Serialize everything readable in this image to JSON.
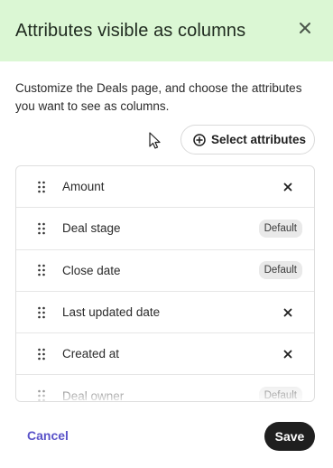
{
  "header": {
    "title": "Attributes visible as columns",
    "close_icon": "close-icon"
  },
  "description": "Customize the Deals page, and choose the attributes you want to see as columns.",
  "select_button": {
    "label": "Select attributes",
    "icon": "plus-circle-icon"
  },
  "attributes": [
    {
      "label": "Amount",
      "action": "remove"
    },
    {
      "label": "Deal stage",
      "badge": "Default"
    },
    {
      "label": "Close date",
      "badge": "Default"
    },
    {
      "label": "Last updated date",
      "action": "remove"
    },
    {
      "label": "Created at",
      "action": "remove"
    },
    {
      "label": "Deal owner",
      "badge": "Default"
    }
  ],
  "footer": {
    "cancel_label": "Cancel",
    "save_label": "Save"
  },
  "colors": {
    "header_bg": "#dbf7d4",
    "accent": "#5a53c9",
    "primary_button": "#1f1f1f"
  }
}
